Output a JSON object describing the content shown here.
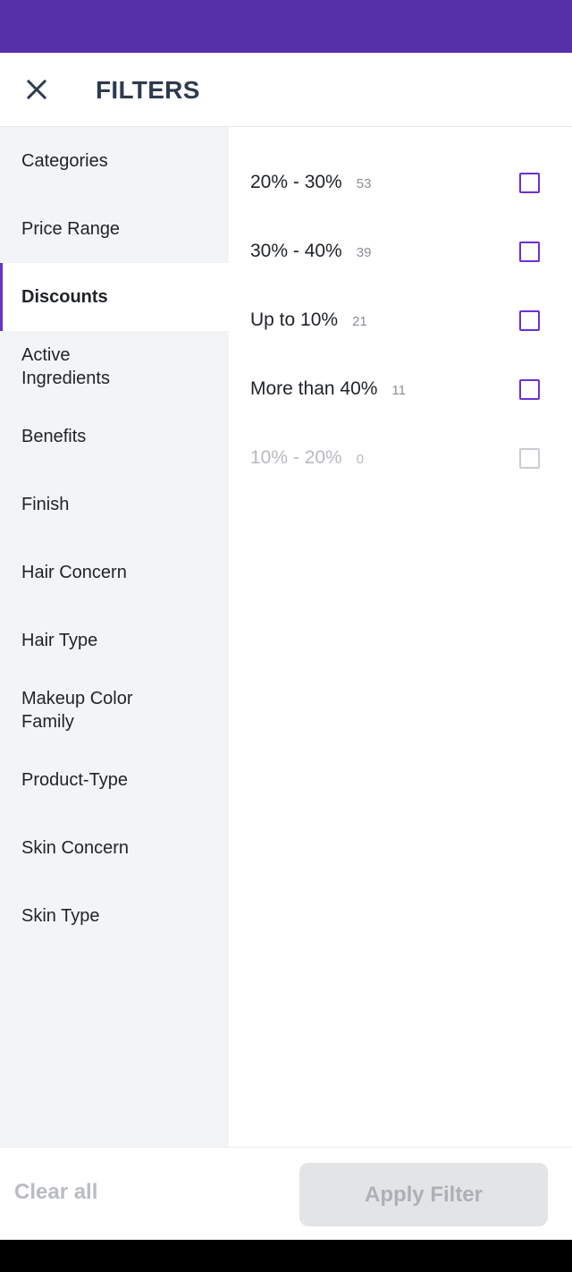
{
  "colors": {
    "status_bar": "#5530a8",
    "accent": "#6b2fd6",
    "title_text": "#2e3b4e"
  },
  "header": {
    "close_icon": "close-icon",
    "title": "FILTERS"
  },
  "sidebar": {
    "items": [
      {
        "label": "Categories",
        "active": false
      },
      {
        "label": "Price Range",
        "active": false
      },
      {
        "label": "Discounts",
        "active": true
      },
      {
        "label": "Active Ingredients",
        "active": false
      },
      {
        "label": "Benefits",
        "active": false
      },
      {
        "label": "Finish",
        "active": false
      },
      {
        "label": "Hair Concern",
        "active": false
      },
      {
        "label": "Hair Type",
        "active": false
      },
      {
        "label": "Makeup Color Family",
        "active": false
      },
      {
        "label": "Product-Type",
        "active": false
      },
      {
        "label": "Skin Concern",
        "active": false
      },
      {
        "label": "Skin Type",
        "active": false
      }
    ]
  },
  "options": [
    {
      "label": "20% - 30%",
      "count": "53",
      "checked": false,
      "disabled": false
    },
    {
      "label": "30% - 40%",
      "count": "39",
      "checked": false,
      "disabled": false
    },
    {
      "label": "Up to 10%",
      "count": "21",
      "checked": false,
      "disabled": false
    },
    {
      "label": "More than 40%",
      "count": "11",
      "checked": false,
      "disabled": false
    },
    {
      "label": "10% - 20%",
      "count": "0",
      "checked": false,
      "disabled": true
    }
  ],
  "footer": {
    "clear_label": "Clear all",
    "apply_label": "Apply Filter"
  }
}
